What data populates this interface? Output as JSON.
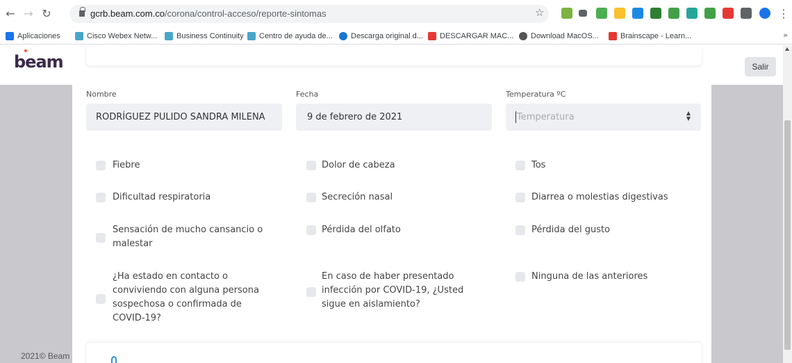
{
  "browser": {
    "url_host": "gcrb.beam.com.co",
    "url_path": "/corona/control-acceso/reporte-sintomas",
    "bookmarks": [
      "Aplicaciones",
      "Cisco Webex Netw...",
      "Business Continuity",
      "Centro de ayuda de...",
      "Descarga original d...",
      "DESCARGAR MAC...",
      "Download MacOS...",
      "Brainscape - Learn..."
    ],
    "more": "»"
  },
  "header": {
    "logo": "beam",
    "logout_label": "Salir"
  },
  "form": {
    "name_label": "Nombre",
    "name_value": "RODRÍGUEZ  PULIDO SANDRA  MILENA",
    "date_label": "Fecha",
    "date_value": "9 de febrero de 2021",
    "temp_label": "Temperatura ºC",
    "temp_placeholder": "Temperatura"
  },
  "symptoms": [
    "Fiebre",
    "Dolor de cabeza",
    "Tos",
    "Dificultad respiratoria",
    "Secreción nasal",
    "Diarrea o molestias digestivas",
    "Sensación de mucho cansancio o malestar",
    "Pérdida del olfato",
    "Pérdida del gusto",
    "¿Ha estado en contacto o conviviendo con alguna persona sospechosa o confirmada de COVID-19?",
    "En caso de haber presentado infección por COVID-19, ¿Usted sigue en aislamiento?",
    "Ninguna de las anteriores"
  ],
  "footer": "2021© Beam"
}
